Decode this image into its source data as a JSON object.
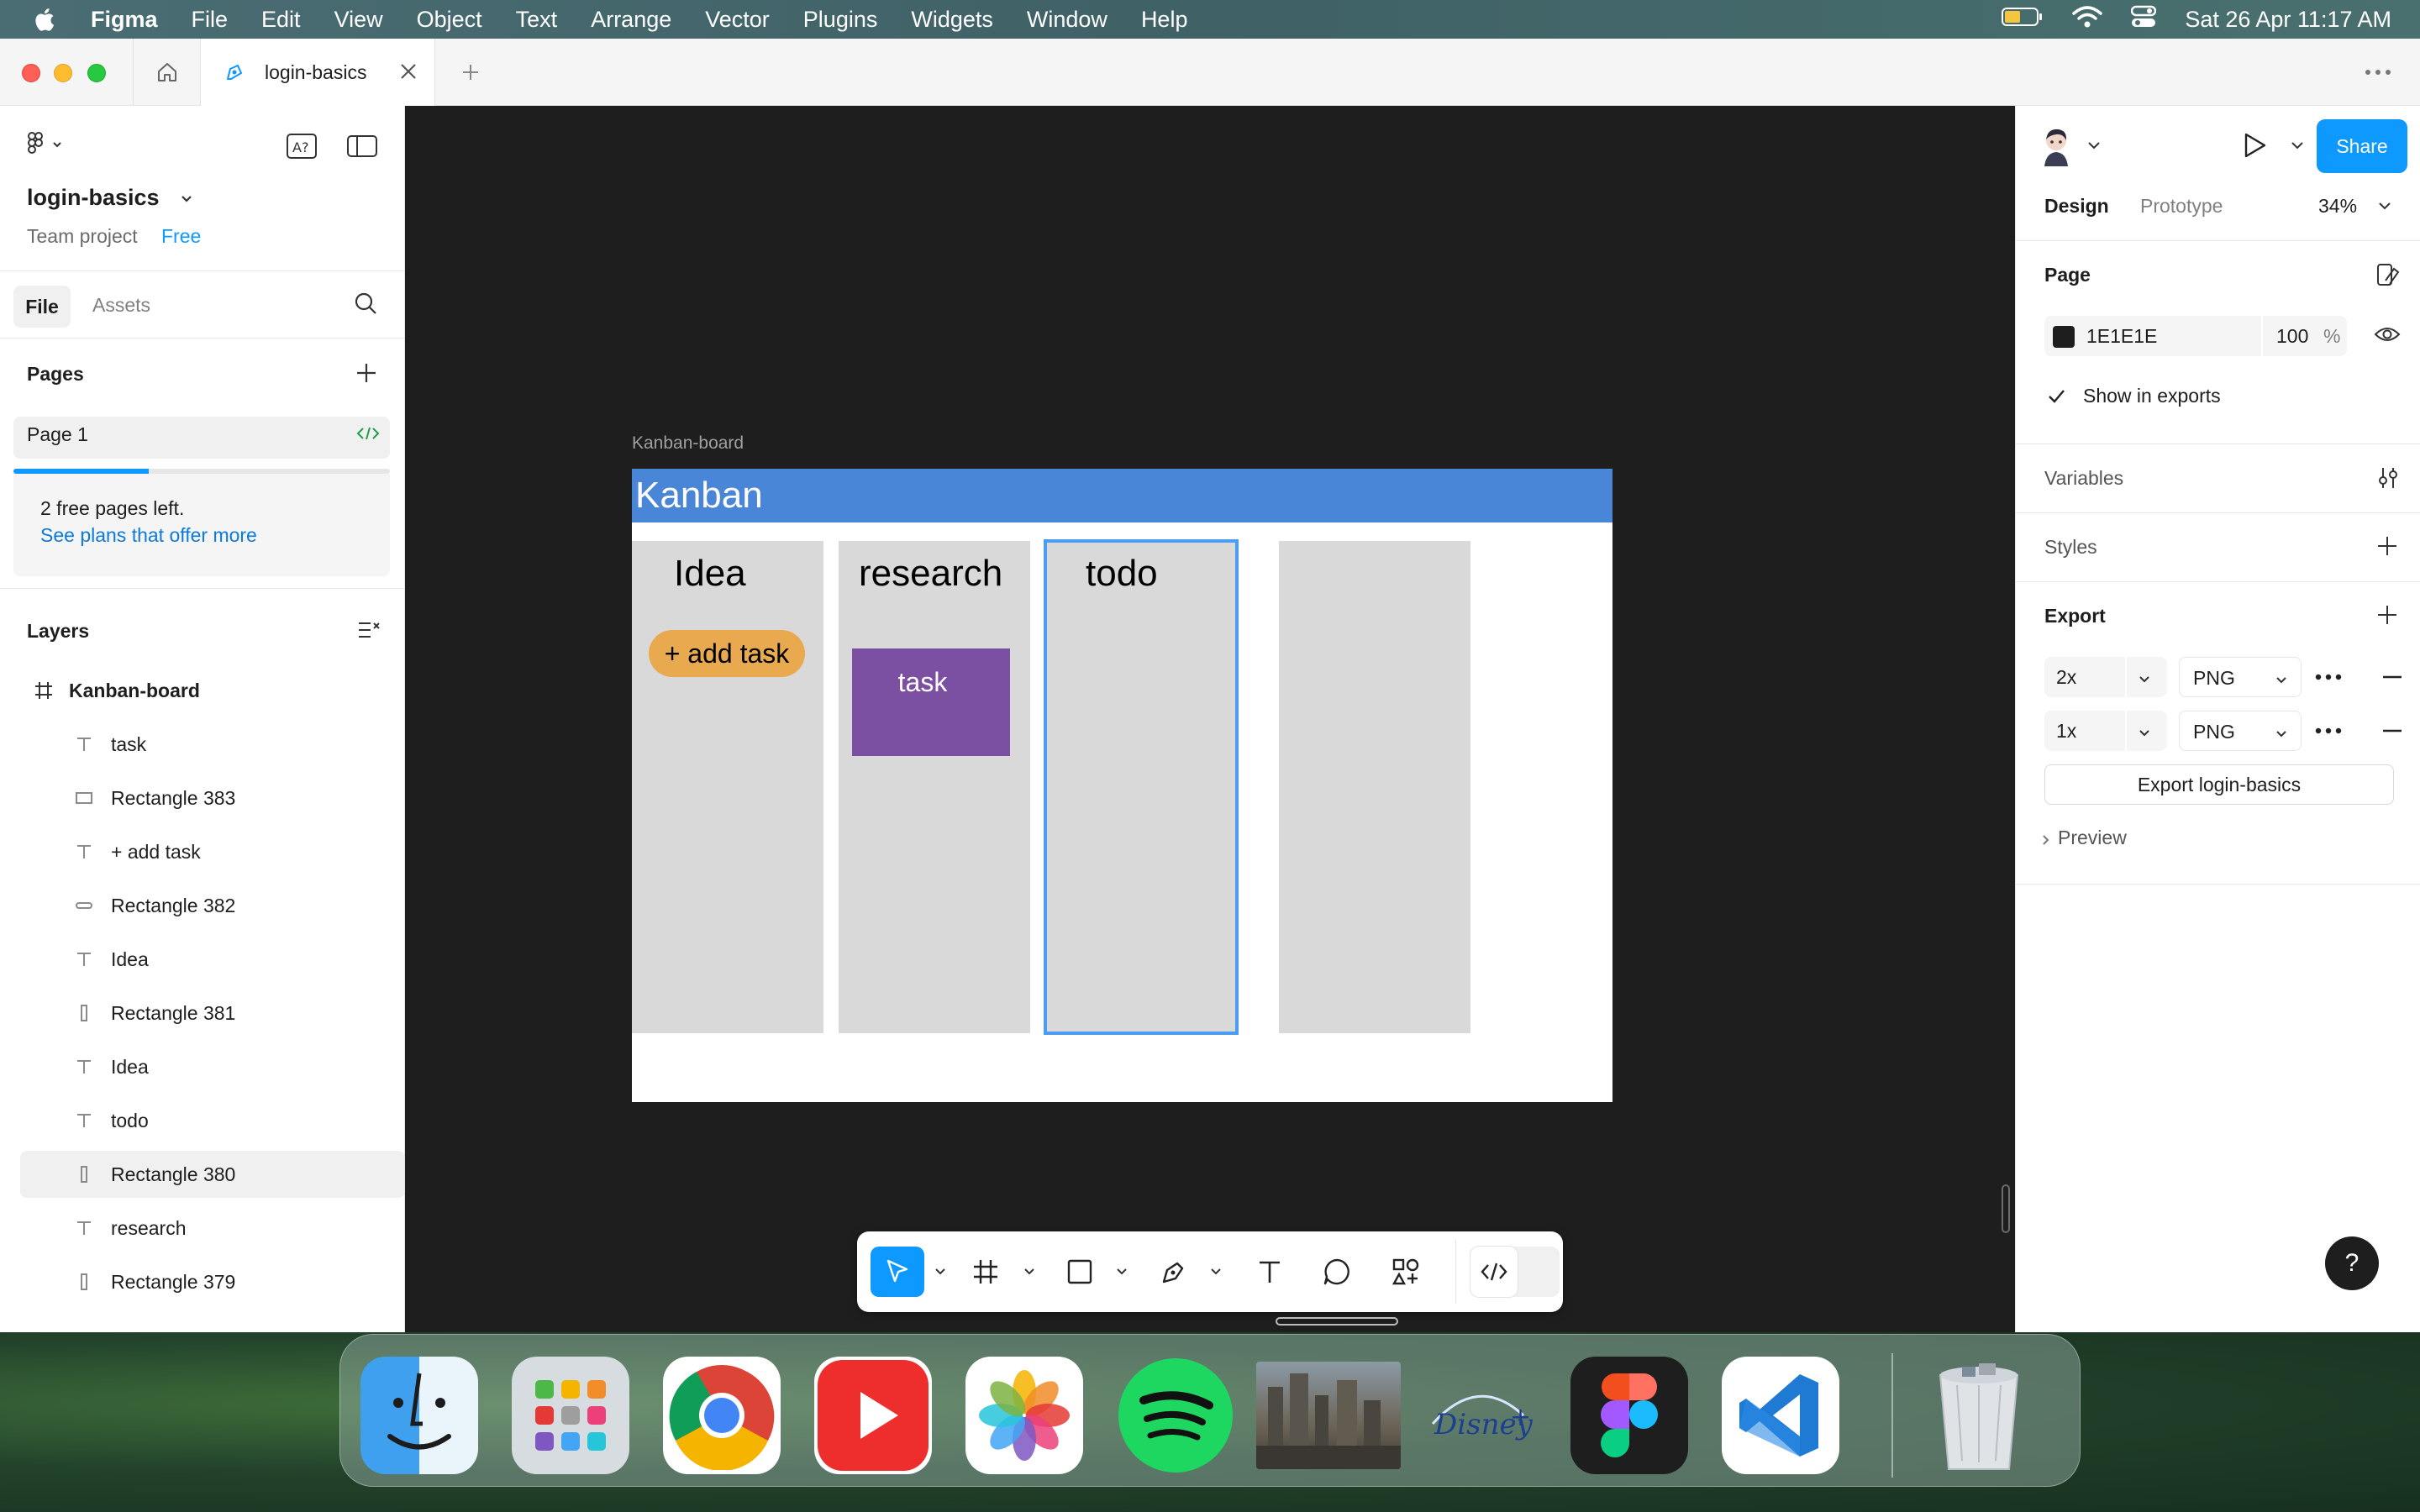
{
  "menubar": {
    "app_name": "Figma",
    "menus": [
      "File",
      "Edit",
      "View",
      "Object",
      "Text",
      "Arrange",
      "Vector",
      "Plugins",
      "Widgets",
      "Window",
      "Help"
    ],
    "clock": "Sat 26 Apr  11:17 AM",
    "battery_level": 0.5
  },
  "tabs": {
    "document_tab": "login-basics"
  },
  "left_panel": {
    "file_name": "login-basics",
    "team_project": "Team project",
    "plan_badge": "Free",
    "tab_file": "File",
    "tab_assets": "Assets",
    "pages_heading": "Pages",
    "page_name": "Page 1",
    "free_pages_progress": 0.36,
    "free_pages_text": "2 free pages left.",
    "plans_link": "See plans that offer more",
    "layers_heading": "Layers",
    "layers": [
      {
        "label": "Kanban-board",
        "icon": "frame-icon",
        "level": 0
      },
      {
        "label": "task",
        "icon": "text-icon",
        "level": 1
      },
      {
        "label": "Rectangle 383",
        "icon": "rectangle-icon",
        "level": 1
      },
      {
        "label": "+ add task",
        "icon": "text-icon",
        "level": 1
      },
      {
        "label": "Rectangle 382",
        "icon": "rounded-rectangle-icon",
        "level": 1
      },
      {
        "label": "Idea",
        "icon": "text-icon",
        "level": 1
      },
      {
        "label": "Rectangle 381",
        "icon": "tall-rectangle-icon",
        "level": 1
      },
      {
        "label": "Idea",
        "icon": "text-icon",
        "level": 1
      },
      {
        "label": "todo",
        "icon": "text-icon",
        "level": 1
      },
      {
        "label": "Rectangle 380",
        "icon": "tall-rectangle-icon",
        "level": 1,
        "selected": true
      },
      {
        "label": "research",
        "icon": "text-icon",
        "level": 1
      },
      {
        "label": "Rectangle 379",
        "icon": "tall-rectangle-icon",
        "level": 1
      }
    ]
  },
  "canvas": {
    "frame_label": "Kanban-board",
    "header_title": "Kanban",
    "columns": [
      "Idea",
      "research",
      "todo"
    ],
    "add_task_label": "+ add task",
    "task_label": "task",
    "colors": {
      "header": "#4a86d8",
      "column": "#d9d9d9",
      "pill": "#e9a94f",
      "task_card": "#7b4fa1",
      "selection": "#4a9df2"
    }
  },
  "toolbar": {
    "tools": [
      "move-tool",
      "frame-tool",
      "shape-tool",
      "pen-tool",
      "text-tool",
      "comment-tool",
      "actions-tool",
      "dev-mode-toggle"
    ]
  },
  "right_panel": {
    "share_label": "Share",
    "tab_design": "Design",
    "tab_prototype": "Prototype",
    "zoom": "34%",
    "page_heading": "Page",
    "page_color_hex": "1E1E1E",
    "page_opacity": "100",
    "percent_sign": "%",
    "show_in_exports": "Show in exports",
    "variables_heading": "Variables",
    "styles_heading": "Styles",
    "export_heading": "Export",
    "exports": [
      {
        "scale": "2x",
        "format": "PNG"
      },
      {
        "scale": "1x",
        "format": "PNG"
      }
    ],
    "export_button": "Export login-basics",
    "preview_label": "Preview",
    "help_label": "?"
  },
  "dock": {
    "apps": [
      "Finder",
      "Launchpad",
      "Chrome",
      "YouTube",
      "Photos",
      "Spotify",
      "Photo",
      "Disney+",
      "Figma",
      "VS Code",
      "Trash"
    ]
  }
}
